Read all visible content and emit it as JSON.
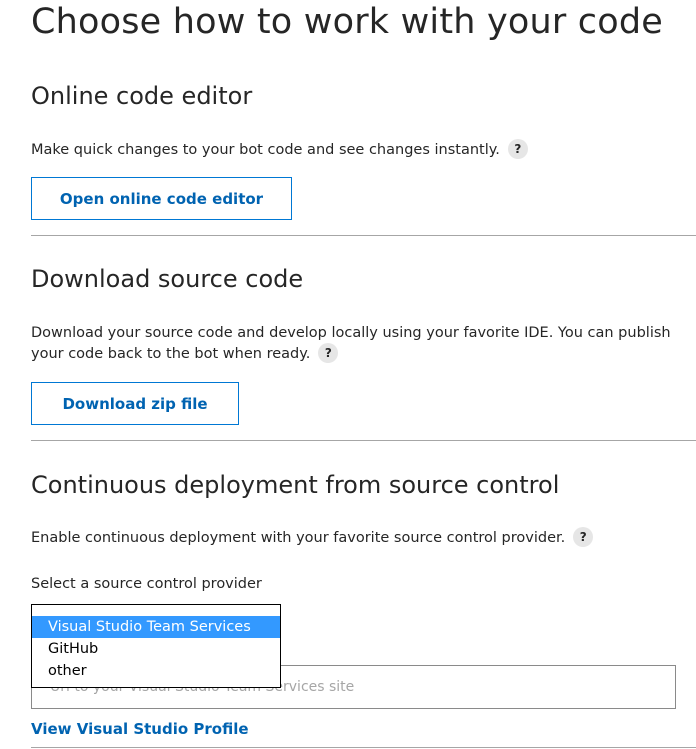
{
  "page": {
    "title": "Choose how to work with your code"
  },
  "online_editor": {
    "heading": "Online code editor",
    "description": "Make quick changes to your bot code and see changes instantly.",
    "help": "?",
    "button_label": "Open online code editor"
  },
  "download": {
    "heading": "Download source code",
    "description": "Download your source code and develop locally using your favorite IDE. You can publish your code back to the bot when ready.",
    "help": "?",
    "button_label": "Download zip file"
  },
  "continuous_deployment": {
    "heading": "Continuous deployment from source control",
    "description": "Enable continuous deployment with your favorite source control provider.",
    "help": "?",
    "select_label": "Select a source control provider",
    "provider_options": [
      {
        "label": "Visual Studio Team Services",
        "selected": true
      },
      {
        "label": "GitHub",
        "selected": false
      },
      {
        "label": "other",
        "selected": false
      }
    ],
    "site_input_placeholder": "Url to your Visual Studio Team Services site",
    "profile_link": "View Visual Studio Profile"
  },
  "colors": {
    "accent": "#0078d4",
    "link": "#0063b1",
    "selection": "#3399ff",
    "divider": "#a6a6a6",
    "help_badge": "#e6e6e6"
  }
}
